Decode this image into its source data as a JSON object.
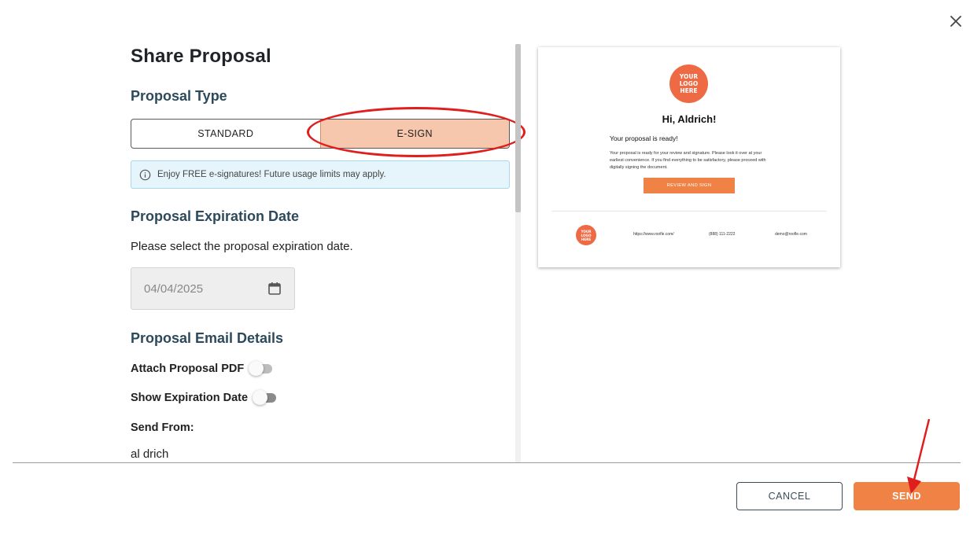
{
  "modal": {
    "title": "Share Proposal",
    "close_label": "close"
  },
  "proposal_type": {
    "heading": "Proposal Type",
    "options": [
      "STANDARD",
      "E-SIGN"
    ],
    "selected": "E-SIGN",
    "info": "Enjoy FREE e-signatures! Future usage limits may apply."
  },
  "expiration": {
    "heading": "Proposal Expiration Date",
    "instruction": "Please select the proposal expiration date.",
    "date_value": "04/04/2025"
  },
  "email_details": {
    "heading": "Proposal Email Details",
    "attach_pdf_label": "Attach Proposal PDF",
    "attach_pdf_on": false,
    "show_expiration_label": "Show Expiration Date",
    "show_expiration_on": false,
    "send_from_label": "Send From:",
    "send_from_value": "al drich"
  },
  "preview": {
    "logo_text": "YOUR LOGO HERE",
    "greeting": "Hi, Aldrich!",
    "ready_text": "Your proposal is ready!",
    "body": "Your proposal is ready for your review and signature. Please look it over at your earliest convenience. If you find everything to be satisfactory, please proceed with digitally signing the document.",
    "button_label": "REVIEW AND SIGN",
    "footer_website": "https://www.roofle.com/",
    "footer_phone": "(888) 111-2222",
    "footer_email": "demo@roofle.com"
  },
  "footer": {
    "cancel_label": "CANCEL",
    "send_label": "SEND"
  },
  "colors": {
    "accent": "#f08246",
    "selected_option": "#f6c6ad",
    "heading": "#2d4a5c",
    "info_bg": "#e6f5fb",
    "annotation": "#e01e1e"
  },
  "icons": [
    "close-icon",
    "info-icon",
    "calendar-icon"
  ]
}
